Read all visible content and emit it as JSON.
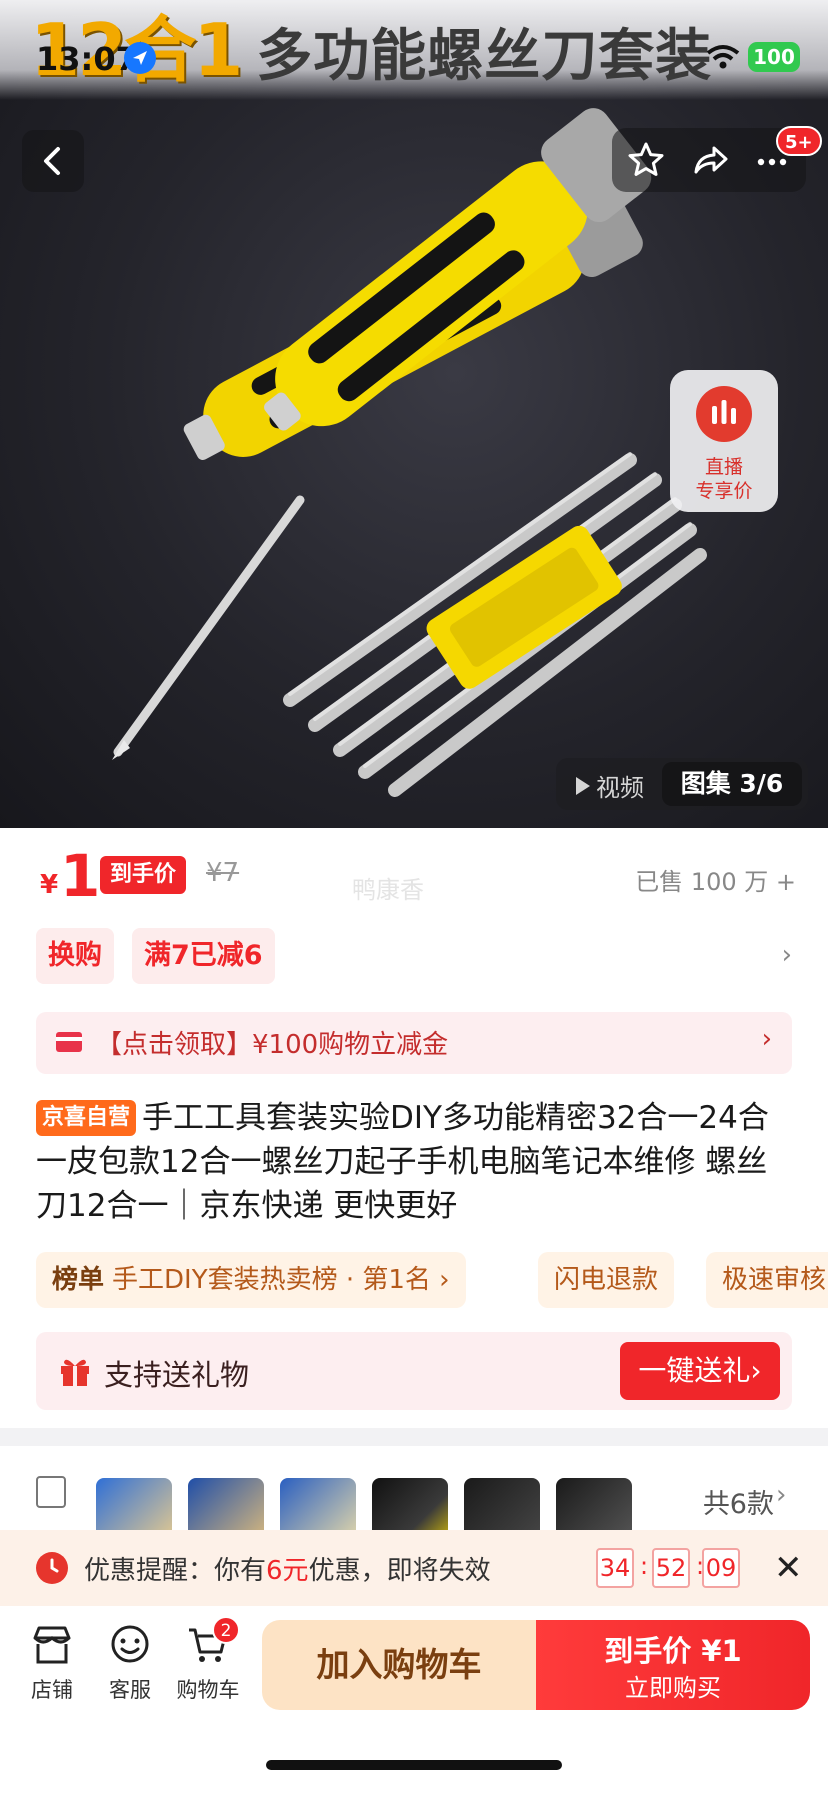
{
  "status_bar": {
    "time": "13:07",
    "battery": "100"
  },
  "hero": {
    "headline_big": "12合1",
    "headline_sub": "多功能螺丝刀套装",
    "nav_badge": "5+",
    "live": {
      "line1": "直播",
      "line2": "专享价"
    },
    "video_tab": "视频",
    "gallery_tab": "图集 3/6"
  },
  "price": {
    "currency": "¥",
    "value": "1",
    "tag": "到手价",
    "original": "¥7",
    "watermark": "鸭康香",
    "sold": "已售 100 万 +"
  },
  "promos": [
    "换购",
    "满7已减6"
  ],
  "coupon": {
    "text": "【点击领取】¥100购物立减金"
  },
  "title": {
    "badge": "京喜自营",
    "text": "手工工具套装实验DIY多功能精密32合一24合一皮包款12合一螺丝刀起子手机电脑笔记本维修 螺丝刀12合一｜京东快递 更快更好"
  },
  "tags": {
    "rank_label": "榜单",
    "rank_text": "手工DIY套装热卖榜 · 第1名 ›",
    "refund": "闪电退款",
    "review": "极速审核"
  },
  "gift": {
    "text": "支持送礼物",
    "button": "一键送礼›"
  },
  "variants": {
    "count": "共6款"
  },
  "reminder": {
    "prefix": "优惠提醒：你有",
    "amount": "6元",
    "suffix": "优惠，即将失效",
    "hh": "34",
    "mm": "52",
    "ss": "09"
  },
  "bottom": {
    "shop": "店铺",
    "service": "客服",
    "cart": "购物车",
    "cart_count": "2",
    "add_cart": "加入购物车",
    "buy_line1": "到手价 ¥1",
    "buy_line2": "立即购买"
  },
  "colors": {
    "accent": "#f0262a",
    "gold": "#f2a900",
    "jx_orange": "#ff6a1b"
  }
}
